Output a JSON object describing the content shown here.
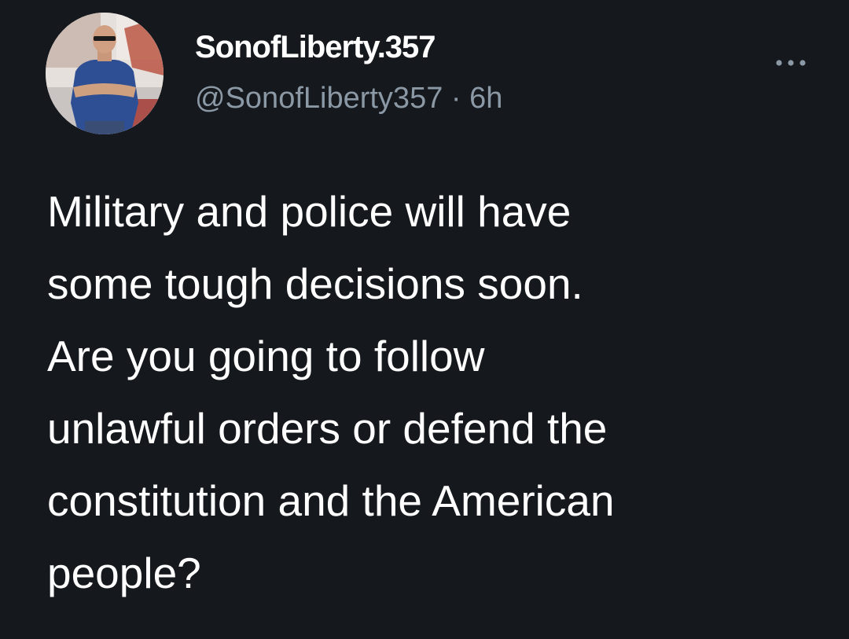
{
  "author": {
    "display_name": "SonofLiberty.357",
    "handle": "@SonofLiberty357",
    "separator": "·",
    "timestamp": "6h",
    "avatar_icon": "profile-photo"
  },
  "actions": {
    "more_icon": "ellipsis-icon"
  },
  "tweet": {
    "lines": [
      "Military and police will have",
      "some tough decisions soon.",
      "Are you going to follow",
      "unlawful orders or defend the",
      "constitution and the American",
      "people?"
    ]
  },
  "colors": {
    "background": "#15181c",
    "primary_text": "#ffffff",
    "secondary_text": "#8b98a5"
  }
}
